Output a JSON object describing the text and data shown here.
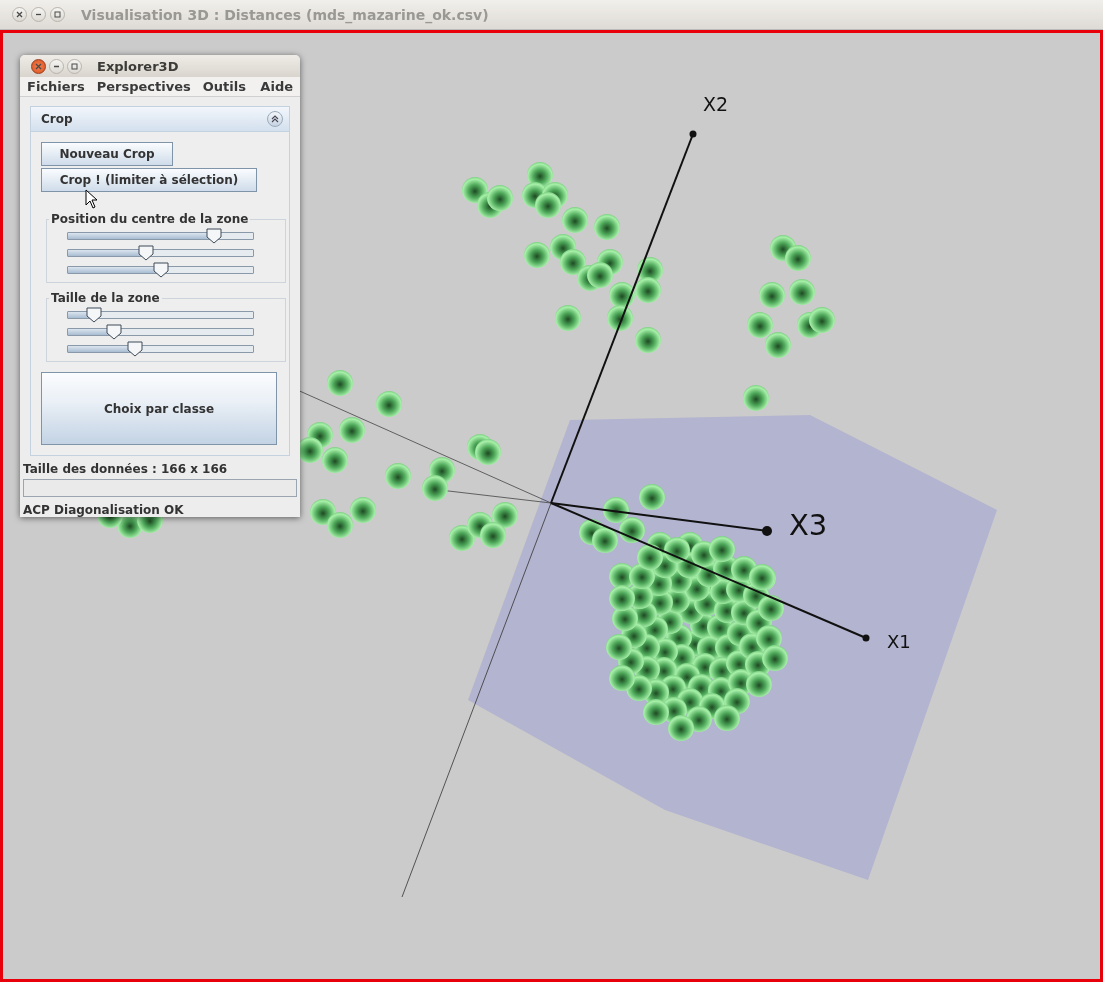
{
  "window": {
    "title": "Visualisation 3D : Distances (mds_mazarine_ok.csv)"
  },
  "scene": {
    "axes": [
      {
        "label": "X2"
      },
      {
        "label": "X3"
      },
      {
        "label": "X1"
      }
    ]
  },
  "explorer": {
    "title": "Explorer3D",
    "menu": [
      "Fichiers",
      "Perspectives",
      "Outils",
      "Aide"
    ],
    "panel": {
      "title": "Crop",
      "expanded": true,
      "buttons": [
        "Nouveau Crop",
        "Crop ! (limiter à sélection)"
      ],
      "groups": [
        {
          "title": "Position du centre de la zone",
          "sliders": [
            {
              "level": 0.79
            },
            {
              "level": 0.42
            },
            {
              "level": 0.5
            }
          ]
        },
        {
          "title": "Taille de la zone",
          "sliders": [
            {
              "level": 0.14
            },
            {
              "level": 0.25
            },
            {
              "level": 0.36
            }
          ]
        }
      ],
      "class_button": "Choix par classe"
    },
    "data_size": "Taille des données : 166 x 166",
    "progress": {
      "level": 0
    },
    "status": "ACP Diagonalisation OK"
  }
}
